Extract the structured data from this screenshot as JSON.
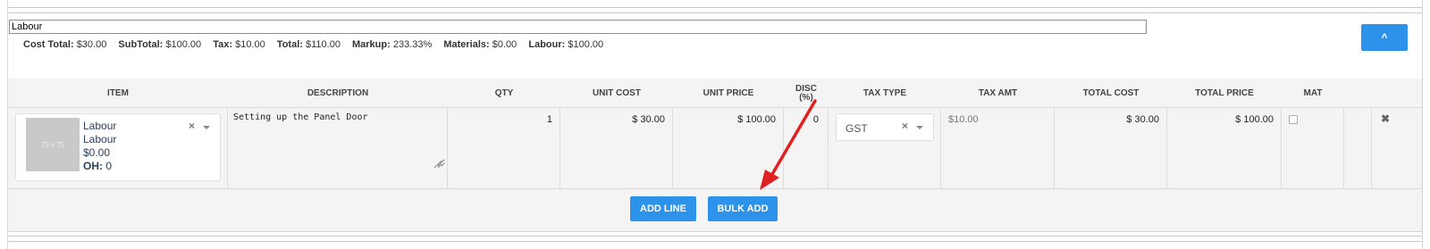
{
  "group": {
    "name": "Labour"
  },
  "totals": [
    {
      "label": "Cost Total:",
      "value": "$30.00"
    },
    {
      "label": "SubTotal:",
      "value": "$100.00"
    },
    {
      "label": "Tax:",
      "value": "$10.00"
    },
    {
      "label": "Total:",
      "value": "$110.00"
    },
    {
      "label": "Markup:",
      "value": "233.33%"
    },
    {
      "label": "Materials:",
      "value": "$0.00"
    },
    {
      "label": "Labour:",
      "value": "$100.00"
    }
  ],
  "collapse_label": "^",
  "columns": {
    "item": "ITEM",
    "description": "DESCRIPTION",
    "qty": "QTY",
    "unit_cost": "UNIT COST",
    "unit_price": "UNIT PRICE",
    "disc_line1": "DISC",
    "disc_line2": "(%)",
    "tax_type": "TAX TYPE",
    "tax_amt": "TAX AMT",
    "total_cost": "TOTAL COST",
    "total_price": "TOTAL PRICE",
    "mat": "MAT"
  },
  "row": {
    "thumb_label": "75 x 75",
    "item_name": "Labour",
    "item_category": "Labour",
    "item_price": "$0.00",
    "oh_label": "OH:",
    "oh_value": "0",
    "description": "Setting up the Panel Door",
    "qty": "1",
    "unit_cost": "$ 30.00",
    "unit_price": "$ 100.00",
    "disc": "0",
    "tax_type": "GST",
    "tax_amt": "$10.00",
    "total_cost": "$ 30.00",
    "total_price": "$ 100.00",
    "mat_checked": false
  },
  "buttons": {
    "add_line": "ADD LINE",
    "bulk_add": "BULK ADD"
  },
  "icons": {
    "clear": "×",
    "remove": "✖"
  },
  "colors": {
    "primary": "#2d93ea",
    "annotation_arrow": "#e02020"
  }
}
